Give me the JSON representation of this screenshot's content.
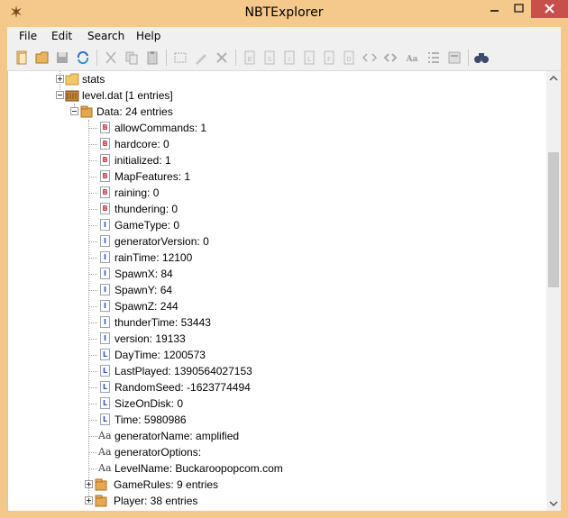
{
  "window": {
    "title": "NBTExplorer",
    "icon": "nbt-explorer-app-icon",
    "controls": [
      "minimize-icon",
      "maximize-icon",
      "close-icon"
    ]
  },
  "menu": {
    "file": "File",
    "edit": "Edit",
    "search": "Search",
    "help": "Help"
  },
  "toolbar": {
    "icons": [
      "open-file-icon",
      "open-folder-icon",
      "save-icon",
      "refresh-icon",
      "cut-icon",
      "copy-icon",
      "paste-icon",
      "rename-icon",
      "edit-icon",
      "delete-icon",
      "add-byte-icon",
      "add-short-icon",
      "add-int-icon",
      "add-long-icon",
      "add-float-icon",
      "add-double-icon",
      "add-byte-array-icon",
      "add-int-array-icon",
      "add-string-icon",
      "add-list-icon",
      "add-compound-icon",
      "find-icon"
    ]
  },
  "tree": {
    "stats": "stats",
    "level_dat": "level.dat [1 entries]",
    "data": "Data: 24 entries",
    "entries": [
      {
        "type": "byte",
        "label": "allowCommands: 1"
      },
      {
        "type": "byte",
        "label": "hardcore: 0"
      },
      {
        "type": "byte",
        "label": "initialized: 1"
      },
      {
        "type": "byte",
        "label": "MapFeatures: 1"
      },
      {
        "type": "byte",
        "label": "raining: 0"
      },
      {
        "type": "byte",
        "label": "thundering: 0"
      },
      {
        "type": "int",
        "label": "GameType: 0"
      },
      {
        "type": "int",
        "label": "generatorVersion: 0"
      },
      {
        "type": "int",
        "label": "rainTime: 12100"
      },
      {
        "type": "int",
        "label": "SpawnX: 84"
      },
      {
        "type": "int",
        "label": "SpawnY: 64"
      },
      {
        "type": "int",
        "label": "SpawnZ: 244"
      },
      {
        "type": "int",
        "label": "thunderTime: 53443"
      },
      {
        "type": "int",
        "label": "version: 19133"
      },
      {
        "type": "long",
        "label": "DayTime: 1200573"
      },
      {
        "type": "long",
        "label": "LastPlayed: 1390564027153"
      },
      {
        "type": "long",
        "label": "RandomSeed: -1623774494"
      },
      {
        "type": "long",
        "label": "SizeOnDisk: 0"
      },
      {
        "type": "long",
        "label": "Time: 5980986"
      },
      {
        "type": "string",
        "label": "generatorName: amplified"
      },
      {
        "type": "string",
        "label": "generatorOptions: "
      },
      {
        "type": "string",
        "label": "LevelName: Buckaroopopcom.com"
      }
    ],
    "game_rules": "GameRules: 9 entries",
    "player": "Player: 38 entries",
    "tag_letters": {
      "byte": "B",
      "int": "I",
      "long": "L",
      "string": "Aa"
    }
  },
  "colors": {
    "titlebar": "#f5c98c",
    "close_button": "#c7504b",
    "tree_background": "#ffffff",
    "byte_tag": "#c0303a",
    "int_tag": "#2a56c8"
  }
}
